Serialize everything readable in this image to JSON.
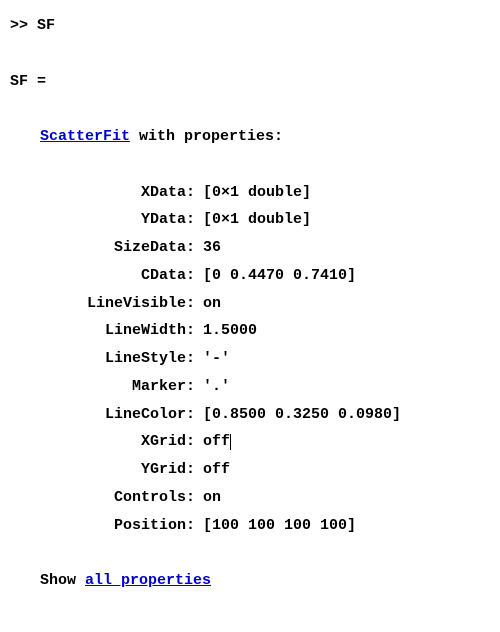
{
  "prompt_prefix": ">> ",
  "command": "SF",
  "echo_var": "SF",
  "echo_equals": " =",
  "class_link": "ScatterFit",
  "class_suffix": " with properties:",
  "properties": [
    {
      "label": "XData:",
      "value": "[0×1 double]"
    },
    {
      "label": "YData:",
      "value": "[0×1 double]"
    },
    {
      "label": "SizeData:",
      "value": "36"
    },
    {
      "label": "CData:",
      "value": "[0 0.4470 0.7410]"
    },
    {
      "label": "LineVisible:",
      "value": "on"
    },
    {
      "label": "LineWidth:",
      "value": "1.5000"
    },
    {
      "label": "LineStyle:",
      "value": "'-'"
    },
    {
      "label": "Marker:",
      "value": "'.'"
    },
    {
      "label": "LineColor:",
      "value": "[0.8500 0.3250 0.0980]"
    },
    {
      "label": "XGrid:",
      "value": "off",
      "caret": true
    },
    {
      "label": "YGrid:",
      "value": "off"
    },
    {
      "label": "Controls:",
      "value": "on"
    },
    {
      "label": "Position:",
      "value": "[100 100 100 100]"
    }
  ],
  "show_prefix": "Show ",
  "show_link": "all properties"
}
